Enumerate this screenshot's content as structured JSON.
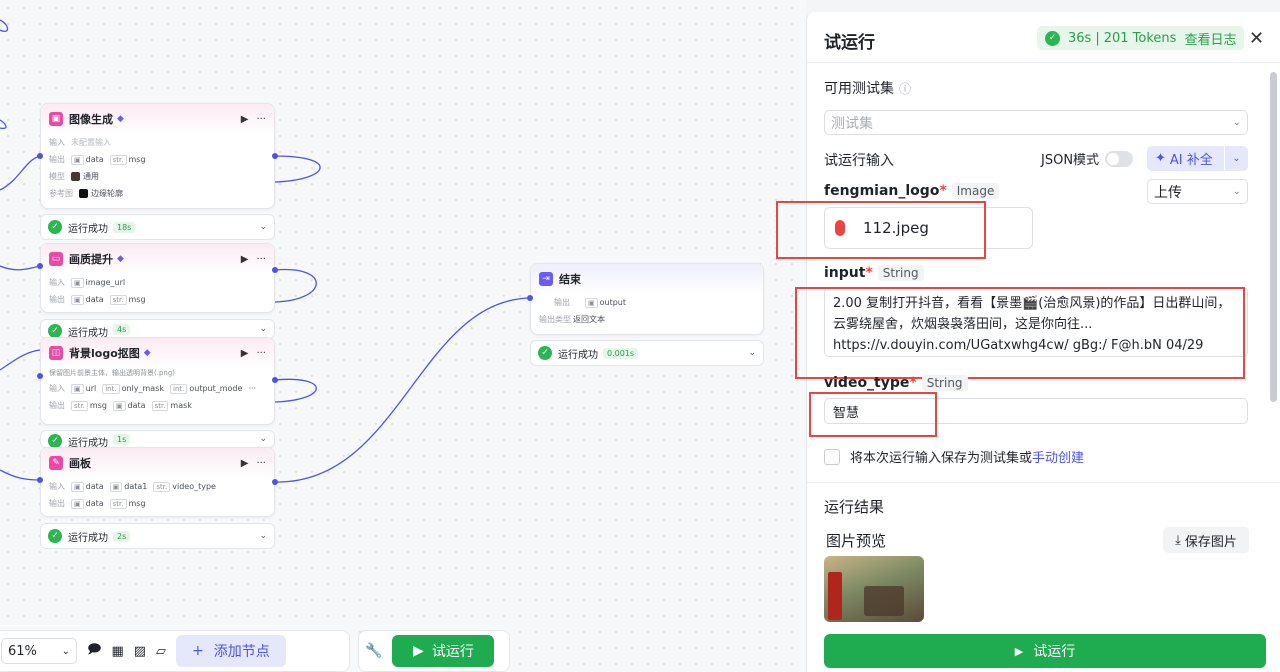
{
  "canvas": {
    "nodes": [
      {
        "title": "图像生成",
        "input_label": "输入",
        "input_value": "未配置输入",
        "output_label": "输出",
        "outputs": [
          "data",
          "msg"
        ],
        "output_types": [
          "▣",
          "str."
        ],
        "model_label": "模型",
        "model_value": "通用",
        "ref_label": "参考图",
        "ref_value": "边缘轮廓"
      },
      {
        "title": "画质提升",
        "input_label": "输入",
        "inputs": [
          "image_url"
        ],
        "output_label": "输出",
        "outputs": [
          "data",
          "msg"
        ]
      },
      {
        "title": "背景logo抠图",
        "desc": "保留图片前景主体，输出透明背景(.png)",
        "input_label": "输入",
        "inputs": [
          "url",
          "only_mask",
          "output_mode"
        ],
        "input_more": "···",
        "output_label": "输出",
        "outputs": [
          "msg",
          "data",
          "mask"
        ]
      },
      {
        "title": "画板",
        "input_label": "输入",
        "inputs": [
          "data",
          "data1",
          "video_type"
        ],
        "output_label": "输出",
        "outputs": [
          "data",
          "msg"
        ]
      },
      {
        "title": "结束",
        "output_label": "输出",
        "outputs": [
          "output"
        ],
        "output_type_label": "输出类型",
        "output_type_value": "返回文本"
      }
    ],
    "statuses": [
      {
        "text": "运行成功",
        "time": "18s"
      },
      {
        "text": "运行成功",
        "time": "4s"
      },
      {
        "text": "运行成功",
        "time": "1s"
      },
      {
        "text": "运行成功",
        "time": "2s"
      },
      {
        "text": "运行成功",
        "time": "0.001s"
      }
    ],
    "type_tags": {
      "str": "str.",
      "int": "int.",
      "img": "▣"
    }
  },
  "toolbar": {
    "zoom": "61%",
    "add_node": "添加节点",
    "run": "试运行"
  },
  "panel": {
    "title": "试运行",
    "duration": "36s",
    "separator": "|",
    "tokens": "201 Tokens",
    "view_log": "查看日志",
    "test_set_label": "可用测试集",
    "test_set_placeholder": "测试集",
    "run_input_label": "试运行输入",
    "json_mode": "JSON模式",
    "ai_fill": "AI 补全",
    "field1": {
      "name": "fengmian_logo",
      "type": "Image",
      "upload": "上传",
      "file": "112.jpeg"
    },
    "field2": {
      "name": "input",
      "type": "String",
      "value": "2.00 复制打开抖音，看看【景墨🎬(治愈风景)的作品】日出群山间，云雾绕屋舍，炊烟袅袅落田间，这是你向往...\nhttps://v.douyin.com/UGatxwhg4cw/ gBg:/ F@h.bN 04/29"
    },
    "field3": {
      "name": "video_type",
      "type": "String",
      "value": "智慧"
    },
    "save_checkbox": "将本次运行输入保存为测试集或",
    "manual_create": "手动创建",
    "result_label": "运行结果",
    "preview_label": "图片预览",
    "save_image": "保存图片",
    "run_button": "试运行"
  },
  "colors": {
    "accent": "#4d53e8",
    "success": "#1fab4f",
    "highlight": "#e8473f",
    "pink": "#e84aa5"
  }
}
